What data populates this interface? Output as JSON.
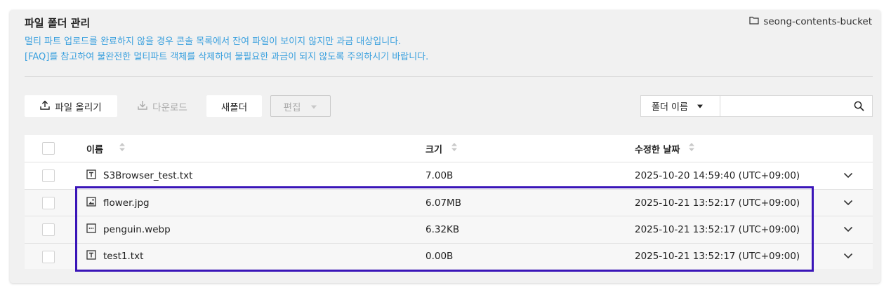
{
  "header": {
    "title": "파일 폴더 관리",
    "bucket_name": "seong-contents-bucket",
    "notice_line1": "멀티 파트 업로드를 완료하지 않을 경우 콘솔 목록에서 잔여 파일이 보이지 않지만 과금 대상입니다.",
    "notice_line2": "[FAQ]를 참고하여 불완전한 멀티파트 객체를 삭제하여 불필요한 과금이 되지 않도록 주의하시기 바랍니다."
  },
  "toolbar": {
    "upload_label": "파일 올리기",
    "download_label": "다운로드",
    "new_folder_label": "새폴더",
    "edit_label": "편집"
  },
  "search": {
    "filter_selected": "폴더 이름",
    "placeholder": ""
  },
  "table": {
    "columns": {
      "name": "이름",
      "size": "크기",
      "modified": "수정한 날짜"
    },
    "rows": [
      {
        "icon": "text-file-icon",
        "name": "S3Browser_test.txt",
        "size": "7.00B",
        "modified": "2025-10-20 14:59:40 (UTC+09:00)"
      },
      {
        "icon": "image-file-icon",
        "name": "flower.jpg",
        "size": "6.07MB",
        "modified": "2025-10-21 13:52:17 (UTC+09:00)"
      },
      {
        "icon": "generic-file-icon",
        "name": "penguin.webp",
        "size": "6.32KB",
        "modified": "2025-10-21 13:52:17 (UTC+09:00)"
      },
      {
        "icon": "text-file-icon",
        "name": "test1.txt",
        "size": "0.00B",
        "modified": "2025-10-21 13:52:17 (UTC+09:00)"
      }
    ]
  },
  "colors": {
    "notice": "#3aa0de",
    "highlight_border": "#3a15b8",
    "panel_bg": "#f1f1f1"
  }
}
